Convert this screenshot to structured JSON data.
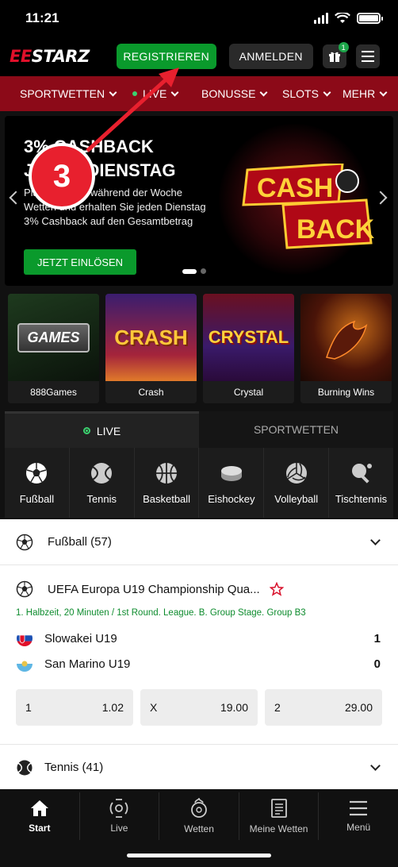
{
  "status_bar": {
    "time": "11:21"
  },
  "header": {
    "logo_prefix": "EE",
    "logo_suffix": "STARZ",
    "register_label": "REGISTRIEREN",
    "login_label": "ANMELDEN",
    "gift_badge": "1"
  },
  "nav": {
    "items": [
      {
        "label": "SPORTWETTEN"
      },
      {
        "label": "LIVE"
      },
      {
        "label": "BONUSSE"
      },
      {
        "label": "SLOTS"
      },
      {
        "label": "MEHR"
      }
    ]
  },
  "banner": {
    "title": "3% CASHBACK JEDEN DIENSTAG",
    "text": "Platzieren Sie während der Woche Wetten und erhalten Sie jeden Dienstag 3% Cashback auf den Gesamtbetrag",
    "cta": "JETZT EINLÖSEN",
    "art_line1": "CASH",
    "art_line2": "BACK"
  },
  "annotation": {
    "step": "3"
  },
  "games": [
    {
      "label": "888Games",
      "art": "GAMES"
    },
    {
      "label": "Crash",
      "art": "CRASH"
    },
    {
      "label": "Crystal",
      "art": "CRYSTAL"
    },
    {
      "label": "Burning Wins",
      "art": ""
    }
  ],
  "tabs": {
    "live": "LIVE",
    "sportwetten": "SPORTWETTEN"
  },
  "sports": [
    {
      "label": "Fußball",
      "icon": "soccer-ball-icon"
    },
    {
      "label": "Tennis",
      "icon": "tennis-ball-icon"
    },
    {
      "label": "Basketball",
      "icon": "basketball-icon"
    },
    {
      "label": "Eishockey",
      "icon": "hockey-puck-icon"
    },
    {
      "label": "Volleyball",
      "icon": "volleyball-icon"
    },
    {
      "label": "Tischtennis",
      "icon": "table-tennis-icon"
    }
  ],
  "list": {
    "football_header": "Fußball (57)",
    "match": {
      "title": "UEFA Europa U19 Championship Qua...",
      "info": "1. Halbzeit, 20 Minuten / 1st Round. League. B. Group Stage. Group B3",
      "team1": "Slowakei U19",
      "score1": "1",
      "team2": "San Marino U19",
      "score2": "0",
      "odds": [
        {
          "label": "1",
          "value": "1.02"
        },
        {
          "label": "X",
          "value": "19.00"
        },
        {
          "label": "2",
          "value": "29.00"
        }
      ]
    },
    "tennis_header": "Tennis (41)"
  },
  "bottom_nav": [
    {
      "label": "Start"
    },
    {
      "label": "Live"
    },
    {
      "label": "Wetten"
    },
    {
      "label": "Meine Wetten"
    },
    {
      "label": "Menü"
    }
  ],
  "colors": {
    "brand_red": "#8c0a18",
    "accent_green": "#0a9a2c"
  }
}
